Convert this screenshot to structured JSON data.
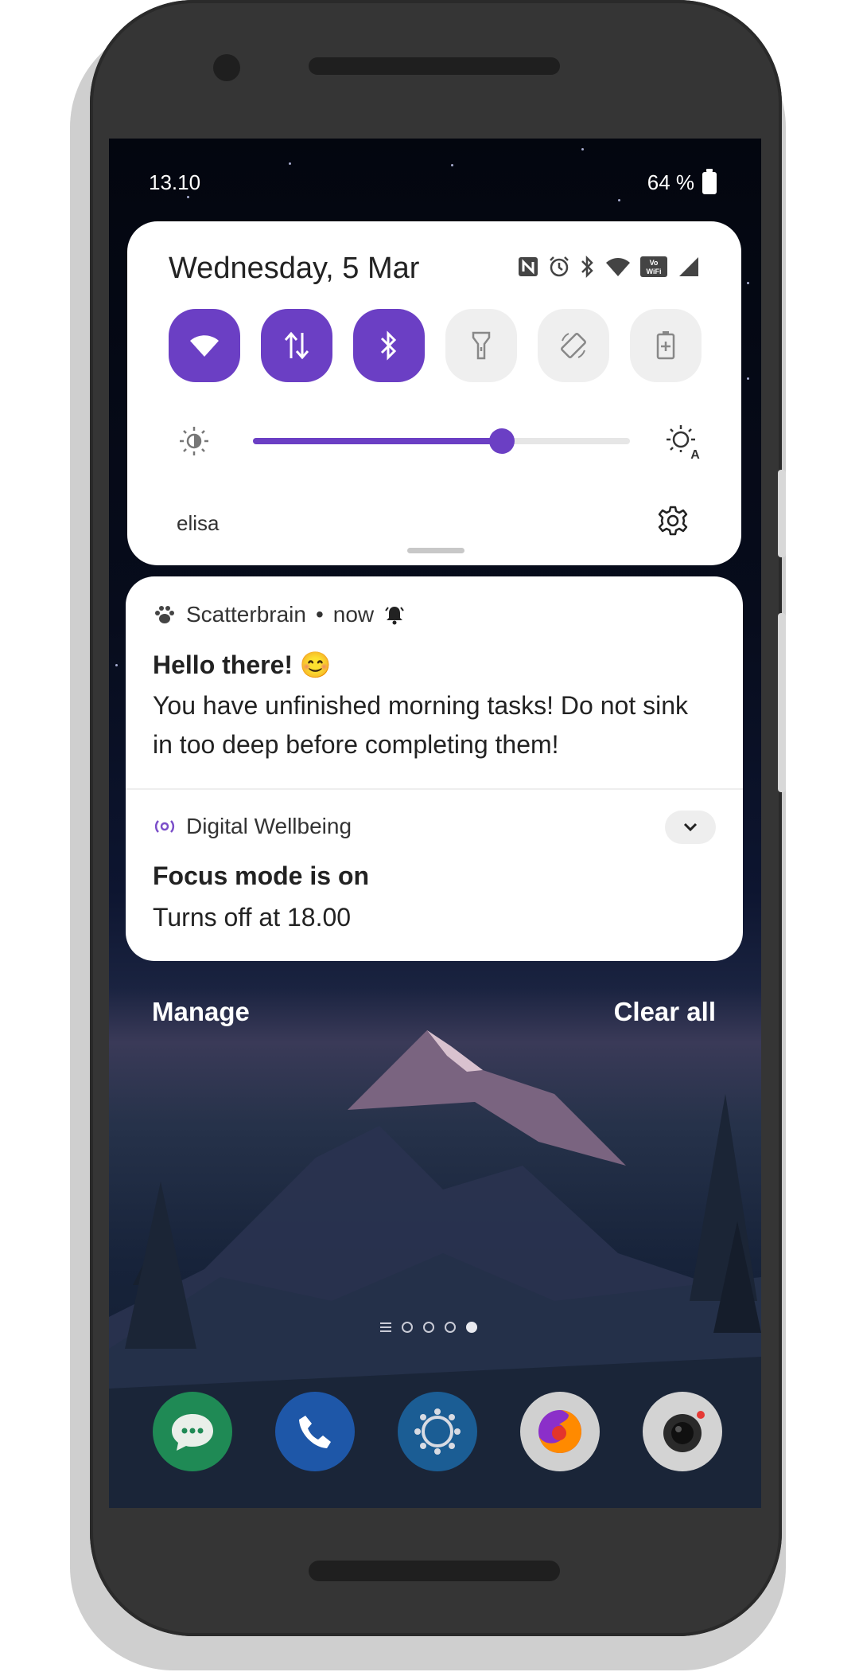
{
  "status_bar": {
    "time": "13.10",
    "battery": "64 %"
  },
  "quick_settings": {
    "date": "Wednesday, 5 Mar",
    "status_icons": [
      "nfc-icon",
      "alarm-icon",
      "bluetooth-icon",
      "wifi-icon",
      "vowifi-icon",
      "signal-icon"
    ],
    "tiles": [
      {
        "name": "wifi",
        "icon": "wifi-icon",
        "active": true
      },
      {
        "name": "mobile-data",
        "icon": "data-arrows-icon",
        "active": true
      },
      {
        "name": "bluetooth",
        "icon": "bluetooth-icon",
        "active": true
      },
      {
        "name": "flashlight",
        "icon": "flashlight-icon",
        "active": false
      },
      {
        "name": "auto-rotate",
        "icon": "rotate-icon",
        "active": false
      },
      {
        "name": "battery-saver",
        "icon": "battery-saver-icon",
        "active": false
      }
    ],
    "brightness_level": 0.66,
    "carrier": "elisa",
    "accent_color": "#6b3fc4"
  },
  "notifications": [
    {
      "app": "Scatterbrain",
      "time": "now",
      "title": "Hello there! 😊",
      "body": "You have unfinished morning tasks! Do not sink in too deep before completing them!"
    },
    {
      "app": "Digital Wellbeing",
      "title": "Focus mode is on",
      "body": "Turns off at 18.00"
    }
  ],
  "actions": {
    "manage": "Manage",
    "clear_all": "Clear all"
  },
  "home": {
    "page_count": 4,
    "active_page": 4,
    "dock_apps": [
      "messages-icon",
      "phone-icon",
      "scatterbrain-icon",
      "firefox-icon",
      "camera-icon"
    ]
  }
}
